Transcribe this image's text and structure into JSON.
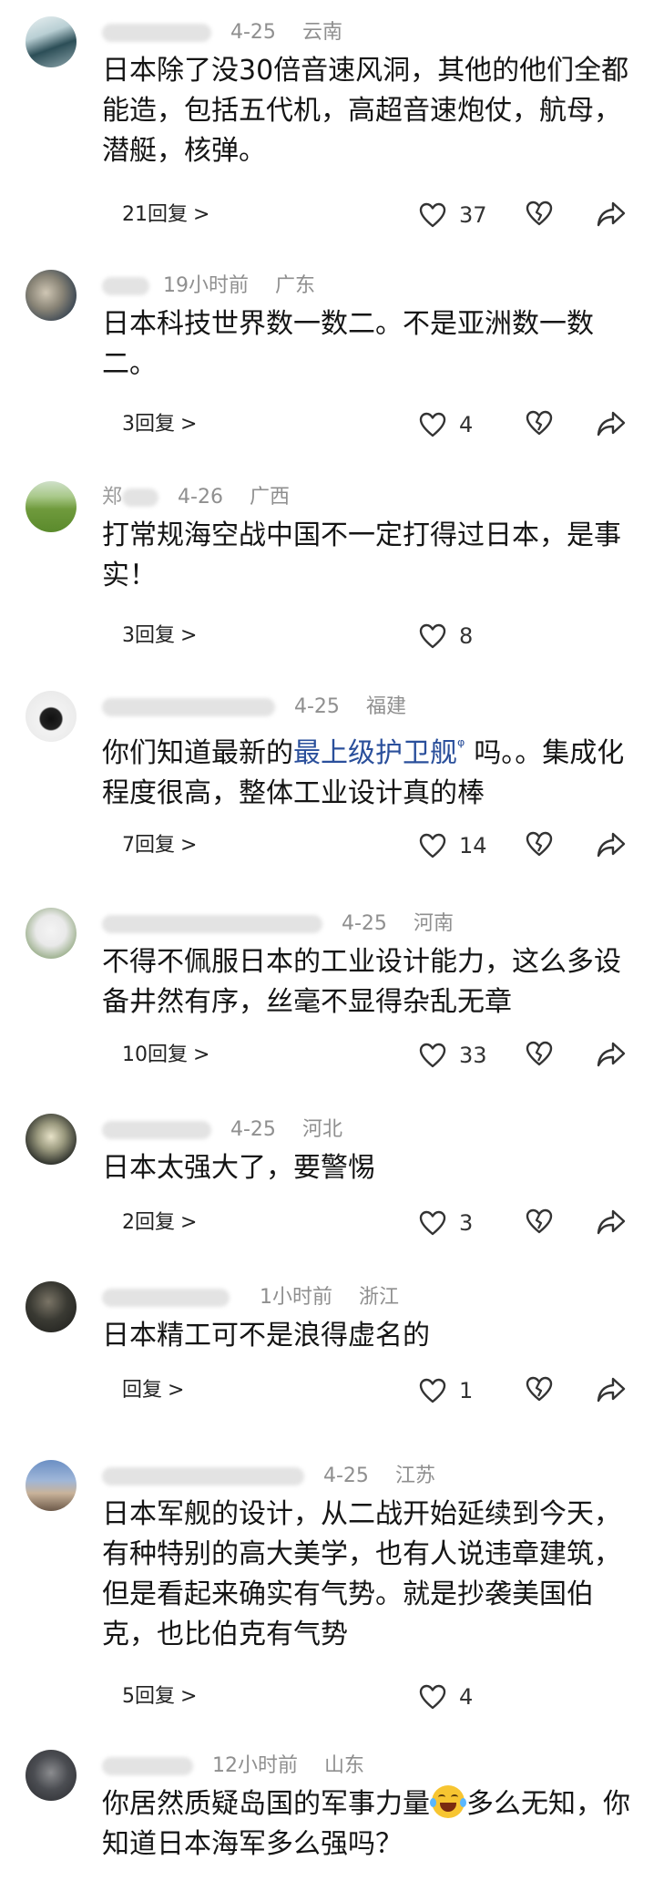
{
  "comments": [
    {
      "time": "4-25",
      "location": "云南",
      "text": "日本除了没30倍音速风洞，其他的他们全都能造，包括五代机，高超音速炮仗，航母，潜艇，核弹。",
      "reply_label": "21回复",
      "likes": "37"
    },
    {
      "time": "19小时前",
      "location": "广东",
      "text": "日本科技世界数一数二。不是亚洲数一数二。",
      "reply_label": "3回复",
      "likes": "4"
    },
    {
      "name_visible": "郑",
      "time": "4-26",
      "location": "广西",
      "text": "打常规海空战中国不一定打得过日本，是事实！",
      "reply_label": "3回复",
      "likes": "8"
    },
    {
      "time": "4-25",
      "location": "福建",
      "text_before": "你们知道最新的",
      "link_text": "最上级护卫舰",
      "text_after": "吗。。集成化程度很高，整体工业设计真的棒",
      "reply_label": "7回复",
      "likes": "14"
    },
    {
      "time": "4-25",
      "location": "河南",
      "text": "不得不佩服日本的工业设计能力，这么多设备井然有序，丝毫不显得杂乱无章",
      "reply_label": "10回复",
      "likes": "33"
    },
    {
      "time": "4-25",
      "location": "河北",
      "text": "日本太强大了，要警惕",
      "reply_label": "2回复",
      "likes": "3"
    },
    {
      "time": "1小时前",
      "location": "浙江",
      "text": "日本精工可不是浪得虚名的",
      "reply_label": "回复",
      "likes": "1"
    },
    {
      "time": "4-25",
      "location": "江苏",
      "text": "日本军舰的设计，从二战开始延续到今天，有种特别的高大美学，也有人说违章建筑，但是看起来确实有气势。就是抄袭美国伯克，也比伯克有气势",
      "reply_label": "5回复",
      "likes": "4"
    },
    {
      "time": "12小时前",
      "location": "山东",
      "text_before": "你居然质疑岛国的军事力量",
      "text_after": "多么无知，你知道日本海军多么强吗？",
      "emoji": "laughing-crying-emoji"
    }
  ],
  "icons": {
    "reply_chevron": ">",
    "search_marker": "ᵠ"
  },
  "colors": {
    "link": "#2a4f9b",
    "meta": "#8f8f8f",
    "text": "#151515"
  }
}
